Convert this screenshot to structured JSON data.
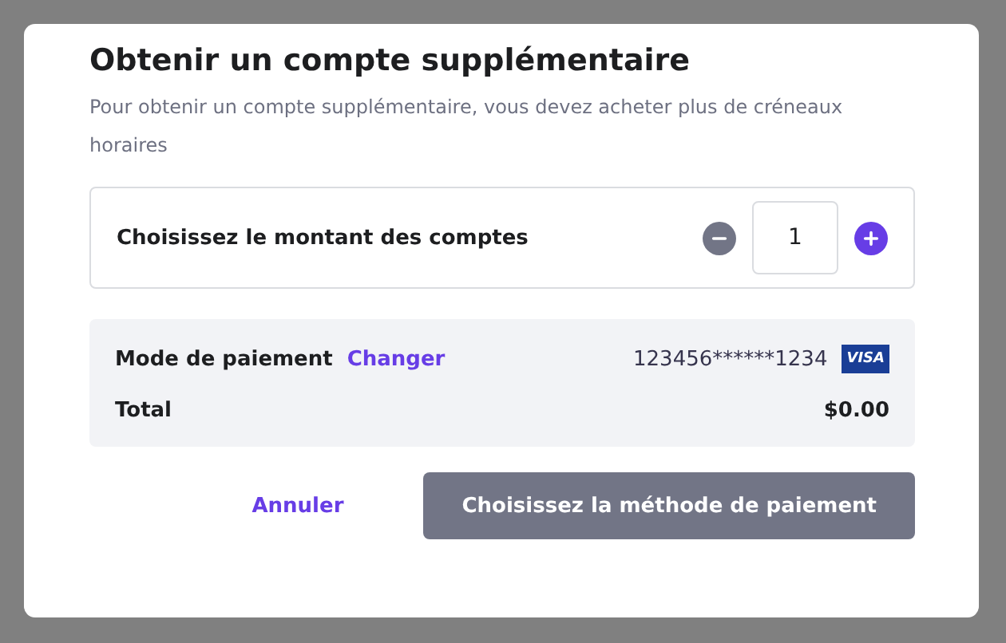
{
  "dialog": {
    "title": "Obtenir un compte supplémentaire",
    "description": "Pour obtenir un compte supplémentaire, vous devez acheter plus de créneaux horaires"
  },
  "quantity": {
    "label": "Choisissez le montant des comptes",
    "value": "1",
    "decrement_disabled": true,
    "increment_disabled": false
  },
  "payment": {
    "label": "Mode de paiement",
    "change_link": "Changer",
    "card_number": "123456******1234",
    "card_brand": "VISA",
    "total_label": "Total",
    "total_value": "$0.00"
  },
  "buttons": [
    {
      "kind": "link",
      "label": "Annuler",
      "disabled": false
    },
    {
      "kind": "primary",
      "label": "Choisissez la méthode de paiement",
      "disabled": true
    }
  ]
}
